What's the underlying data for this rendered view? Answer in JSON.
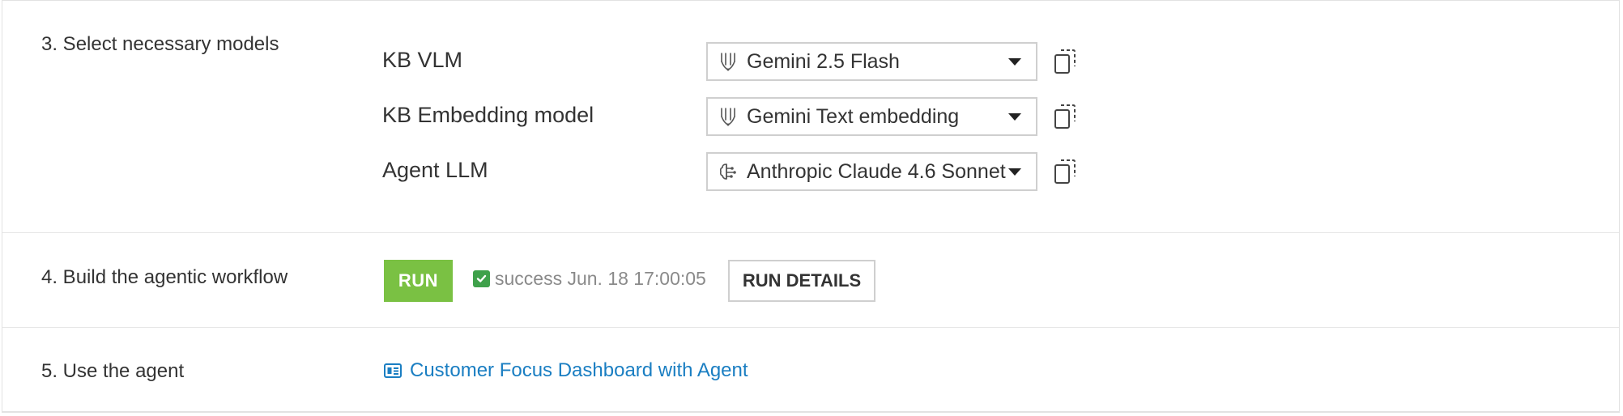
{
  "steps": {
    "select_models": {
      "label": "3. Select necessary models",
      "models": [
        {
          "label": "KB VLM",
          "value": "Gemini 2.5 Flash",
          "icon": "gemini-icon"
        },
        {
          "label": "KB Embedding model",
          "value": "Gemini Text embedding",
          "icon": "gemini-icon"
        },
        {
          "label": "Agent LLM",
          "value": "Anthropic Claude 4.6 Sonnet",
          "icon": "anthropic-brain-icon"
        }
      ]
    },
    "build_workflow": {
      "label": "4. Build the agentic workflow",
      "run_label": "RUN",
      "status_text": "success Jun. 18 17:00:05",
      "details_label": "RUN DETAILS"
    },
    "use_agent": {
      "label": "5. Use the agent",
      "link_text": "Customer Focus Dashboard with Agent",
      "link_icon": "dashboard-icon"
    }
  },
  "colors": {
    "run_button": "#7ac143",
    "success_check": "#3fa14b",
    "link": "#1a7ec2"
  }
}
